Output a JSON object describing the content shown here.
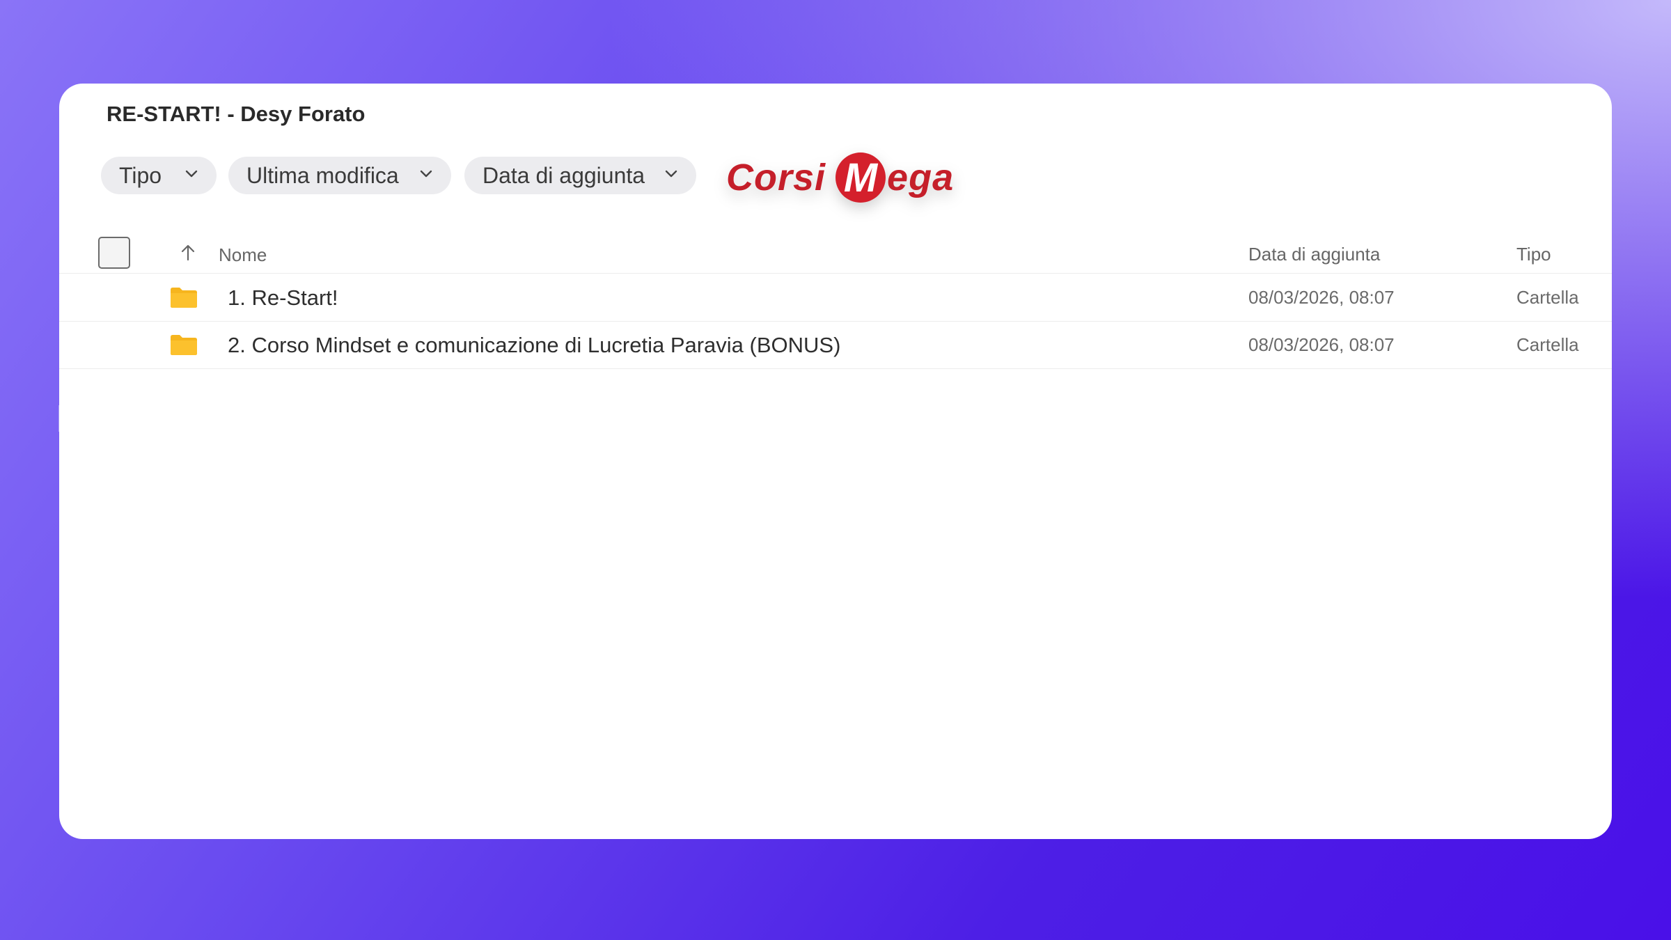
{
  "window": {
    "title": "RE-START! - Desy Forato"
  },
  "filters": [
    {
      "label": "Tipo"
    },
    {
      "label": "Ultima modifica"
    },
    {
      "label": "Data di aggiunta"
    }
  ],
  "logo": {
    "part1": "Corsi",
    "letter": "M",
    "part2": "ega",
    "color": "#d4202c"
  },
  "table": {
    "columns": {
      "name": "Nome",
      "date_added": "Data di aggiunta",
      "type": "Tipo"
    },
    "sort_icon": "arrow-up-icon",
    "rows": [
      {
        "icon": "folder-icon",
        "name": "1. Re-Start!",
        "date_added": "08/03/2026, 08:07",
        "type": "Cartella"
      },
      {
        "icon": "folder-icon",
        "name": "2. Corso Mindset e comunicazione di Lucretia Paravia (BONUS)",
        "date_added": "08/03/2026, 08:07",
        "type": "Cartella"
      }
    ]
  },
  "colors": {
    "background_accent": "#5a2bf0",
    "folder": "#f6b51e"
  }
}
